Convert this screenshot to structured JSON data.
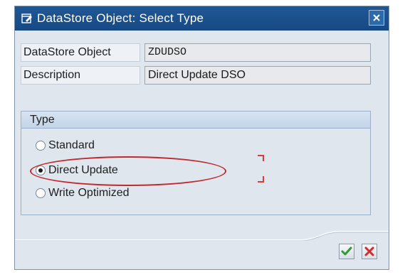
{
  "window": {
    "title": "DataStore Object: Select Type"
  },
  "fields": [
    {
      "label": "DataStore Object",
      "value": "ZDUDSO"
    },
    {
      "label": "Description",
      "value": "Direct Update DSO"
    }
  ],
  "type_group": {
    "header": "Type",
    "options": [
      {
        "label": "Standard",
        "selected": false
      },
      {
        "label": "Direct Update",
        "selected": true
      },
      {
        "label": "Write Optimized",
        "selected": false
      }
    ]
  },
  "buttons": {
    "ok_icon": "check-icon",
    "cancel_icon": "cancel-x-icon"
  },
  "colors": {
    "title_bar": "#1f5795",
    "annotation": "#c0292d",
    "ok_green": "#2e9b2e",
    "cancel_red": "#d12b2b"
  }
}
